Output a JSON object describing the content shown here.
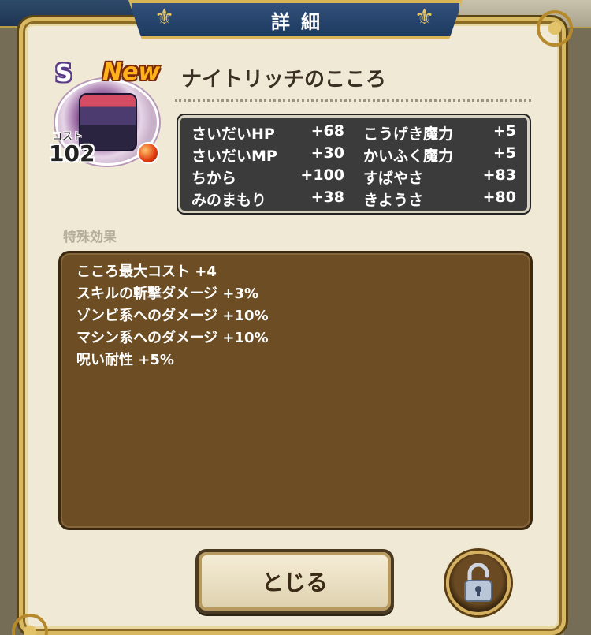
{
  "dialog": {
    "title": "詳細"
  },
  "item": {
    "rank": "S",
    "badge": "New",
    "name": "ナイトリッチのこころ",
    "cost_label": "コスト",
    "cost_value": "102",
    "gem_color": "#e23a10"
  },
  "stats": [
    {
      "left_label": "さいだいHP",
      "left_value": "+68",
      "right_label": "こうげき魔力",
      "right_value": "+5"
    },
    {
      "left_label": "さいだいMP",
      "left_value": "+30",
      "right_label": "かいふく魔力",
      "right_value": "+5"
    },
    {
      "left_label": "ちから",
      "left_value": "+100",
      "right_label": "すばやさ",
      "right_value": "+83"
    },
    {
      "left_label": "みのまもり",
      "left_value": "+38",
      "right_label": "きようさ",
      "right_value": "+80"
    }
  ],
  "special": {
    "title": "特殊効果",
    "effects": [
      "こころ最大コスト +4",
      "スキルの斬撃ダメージ +3%",
      "ゾンビ系へのダメージ +10%",
      "マシン系へのダメージ +10%",
      "呪い耐性 +5%"
    ]
  },
  "buttons": {
    "close_label": "とじる",
    "lock_icon": "unlocked-padlock-icon"
  }
}
